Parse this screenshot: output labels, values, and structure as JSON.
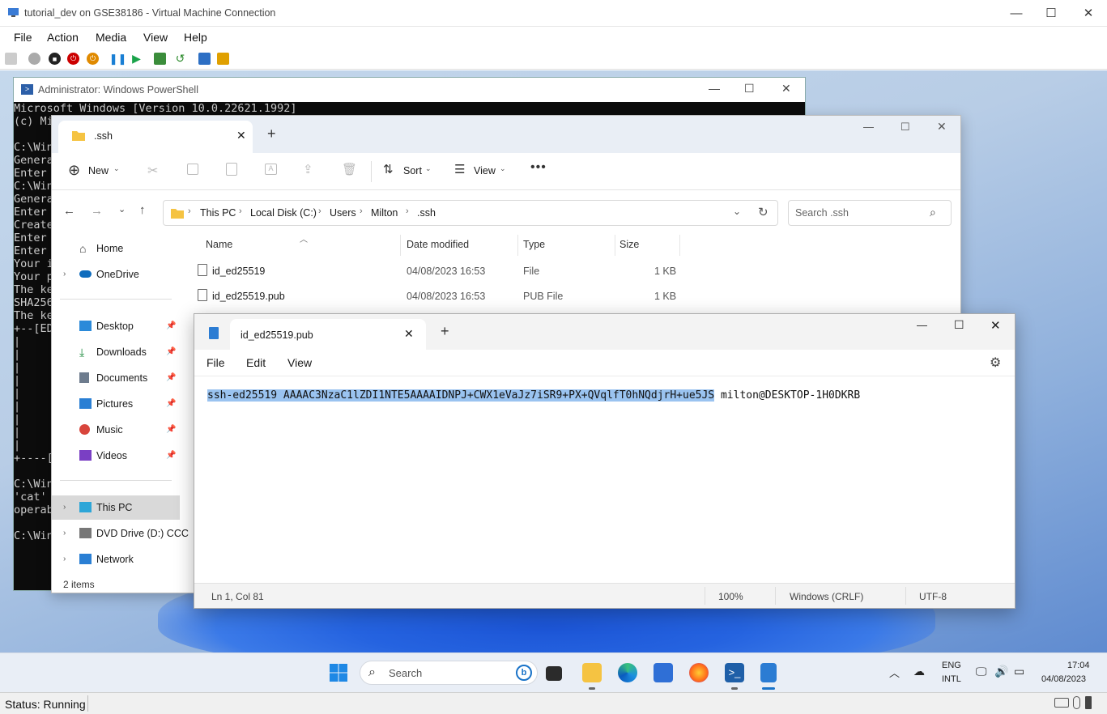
{
  "vm": {
    "title": "tutorial_dev on GSE38186 - Virtual Machine Connection",
    "menu": [
      "File",
      "Action",
      "Media",
      "View",
      "Help"
    ],
    "status": "Status: Running"
  },
  "powershell": {
    "title": "Administrator: Windows PowerShell",
    "lines": [
      "Microsoft Windows [Version 10.0.22621.1992]",
      "(c) Mi",
      "",
      "C:\\Win",
      "Genera",
      "Enter ",
      "C:\\Win",
      "Genera",
      "Enter ",
      "Create",
      "Enter ",
      "Enter ",
      "Your i",
      "Your p",
      "The ke",
      "SHA256",
      "The ke",
      "+--[ED",
      "|",
      "|",
      "|",
      "|",
      "|",
      "|",
      "|",
      "|",
      "|",
      "+----[",
      "",
      "C:\\Win",
      "'cat' ",
      "operab",
      "",
      "C:\\Win"
    ]
  },
  "explorer": {
    "tab_title": ".ssh",
    "toolbar": {
      "new": "New",
      "sort": "Sort",
      "view": "View"
    },
    "breadcrumb": [
      "This PC",
      "Local Disk (C:)",
      "Users",
      "Milton",
      ".ssh"
    ],
    "search_placeholder": "Search .ssh",
    "nav": {
      "home": "Home",
      "onedrive": "OneDrive",
      "desktop": "Desktop",
      "downloads": "Downloads",
      "documents": "Documents",
      "pictures": "Pictures",
      "music": "Music",
      "videos": "Videos",
      "thispc": "This PC",
      "dvd": "DVD Drive (D:) CCC",
      "network": "Network"
    },
    "columns": {
      "name": "Name",
      "date": "Date modified",
      "type": "Type",
      "size": "Size"
    },
    "files": [
      {
        "name": "id_ed25519",
        "date": "04/08/2023 16:53",
        "type": "File",
        "size": "1 KB"
      },
      {
        "name": "id_ed25519.pub",
        "date": "04/08/2023 16:53",
        "type": "PUB File",
        "size": "1 KB"
      }
    ],
    "status": "2 items"
  },
  "notepad": {
    "tab_title": "id_ed25519.pub",
    "menu": {
      "file": "File",
      "edit": "Edit",
      "view": "View"
    },
    "selected_text": "ssh-ed25519 AAAAC3NzaC1lZDI1NTE5AAAAIDNPJ+CWX1eVaJz7iSR9+PX+QVqlfT0hNQdjrH+ue5JS",
    "rest_text": " milton@DESKTOP-1H0DKRB",
    "status": {
      "position": "Ln 1, Col 81",
      "zoom": "100%",
      "eol": "Windows (CRLF)",
      "encoding": "UTF-8"
    }
  },
  "taskbar": {
    "search": "Search",
    "lang1": "ENG",
    "lang2": "INTL",
    "time": "17:04",
    "date": "04/08/2023"
  }
}
